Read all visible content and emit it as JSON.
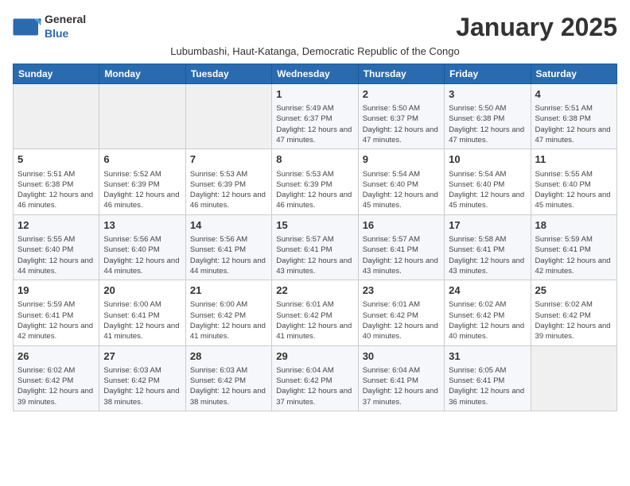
{
  "logo": {
    "general": "General",
    "blue": "Blue"
  },
  "title": "January 2025",
  "subtitle": "Lubumbashi, Haut-Katanga, Democratic Republic of the Congo",
  "days_of_week": [
    "Sunday",
    "Monday",
    "Tuesday",
    "Wednesday",
    "Thursday",
    "Friday",
    "Saturday"
  ],
  "weeks": [
    [
      {
        "day": "",
        "info": ""
      },
      {
        "day": "",
        "info": ""
      },
      {
        "day": "",
        "info": ""
      },
      {
        "day": "1",
        "info": "Sunrise: 5:49 AM\nSunset: 6:37 PM\nDaylight: 12 hours and 47 minutes."
      },
      {
        "day": "2",
        "info": "Sunrise: 5:50 AM\nSunset: 6:37 PM\nDaylight: 12 hours and 47 minutes."
      },
      {
        "day": "3",
        "info": "Sunrise: 5:50 AM\nSunset: 6:38 PM\nDaylight: 12 hours and 47 minutes."
      },
      {
        "day": "4",
        "info": "Sunrise: 5:51 AM\nSunset: 6:38 PM\nDaylight: 12 hours and 47 minutes."
      }
    ],
    [
      {
        "day": "5",
        "info": "Sunrise: 5:51 AM\nSunset: 6:38 PM\nDaylight: 12 hours and 46 minutes."
      },
      {
        "day": "6",
        "info": "Sunrise: 5:52 AM\nSunset: 6:39 PM\nDaylight: 12 hours and 46 minutes."
      },
      {
        "day": "7",
        "info": "Sunrise: 5:53 AM\nSunset: 6:39 PM\nDaylight: 12 hours and 46 minutes."
      },
      {
        "day": "8",
        "info": "Sunrise: 5:53 AM\nSunset: 6:39 PM\nDaylight: 12 hours and 46 minutes."
      },
      {
        "day": "9",
        "info": "Sunrise: 5:54 AM\nSunset: 6:40 PM\nDaylight: 12 hours and 45 minutes."
      },
      {
        "day": "10",
        "info": "Sunrise: 5:54 AM\nSunset: 6:40 PM\nDaylight: 12 hours and 45 minutes."
      },
      {
        "day": "11",
        "info": "Sunrise: 5:55 AM\nSunset: 6:40 PM\nDaylight: 12 hours and 45 minutes."
      }
    ],
    [
      {
        "day": "12",
        "info": "Sunrise: 5:55 AM\nSunset: 6:40 PM\nDaylight: 12 hours and 44 minutes."
      },
      {
        "day": "13",
        "info": "Sunrise: 5:56 AM\nSunset: 6:40 PM\nDaylight: 12 hours and 44 minutes."
      },
      {
        "day": "14",
        "info": "Sunrise: 5:56 AM\nSunset: 6:41 PM\nDaylight: 12 hours and 44 minutes."
      },
      {
        "day": "15",
        "info": "Sunrise: 5:57 AM\nSunset: 6:41 PM\nDaylight: 12 hours and 43 minutes."
      },
      {
        "day": "16",
        "info": "Sunrise: 5:57 AM\nSunset: 6:41 PM\nDaylight: 12 hours and 43 minutes."
      },
      {
        "day": "17",
        "info": "Sunrise: 5:58 AM\nSunset: 6:41 PM\nDaylight: 12 hours and 43 minutes."
      },
      {
        "day": "18",
        "info": "Sunrise: 5:59 AM\nSunset: 6:41 PM\nDaylight: 12 hours and 42 minutes."
      }
    ],
    [
      {
        "day": "19",
        "info": "Sunrise: 5:59 AM\nSunset: 6:41 PM\nDaylight: 12 hours and 42 minutes."
      },
      {
        "day": "20",
        "info": "Sunrise: 6:00 AM\nSunset: 6:41 PM\nDaylight: 12 hours and 41 minutes."
      },
      {
        "day": "21",
        "info": "Sunrise: 6:00 AM\nSunset: 6:42 PM\nDaylight: 12 hours and 41 minutes."
      },
      {
        "day": "22",
        "info": "Sunrise: 6:01 AM\nSunset: 6:42 PM\nDaylight: 12 hours and 41 minutes."
      },
      {
        "day": "23",
        "info": "Sunrise: 6:01 AM\nSunset: 6:42 PM\nDaylight: 12 hours and 40 minutes."
      },
      {
        "day": "24",
        "info": "Sunrise: 6:02 AM\nSunset: 6:42 PM\nDaylight: 12 hours and 40 minutes."
      },
      {
        "day": "25",
        "info": "Sunrise: 6:02 AM\nSunset: 6:42 PM\nDaylight: 12 hours and 39 minutes."
      }
    ],
    [
      {
        "day": "26",
        "info": "Sunrise: 6:02 AM\nSunset: 6:42 PM\nDaylight: 12 hours and 39 minutes."
      },
      {
        "day": "27",
        "info": "Sunrise: 6:03 AM\nSunset: 6:42 PM\nDaylight: 12 hours and 38 minutes."
      },
      {
        "day": "28",
        "info": "Sunrise: 6:03 AM\nSunset: 6:42 PM\nDaylight: 12 hours and 38 minutes."
      },
      {
        "day": "29",
        "info": "Sunrise: 6:04 AM\nSunset: 6:42 PM\nDaylight: 12 hours and 37 minutes."
      },
      {
        "day": "30",
        "info": "Sunrise: 6:04 AM\nSunset: 6:41 PM\nDaylight: 12 hours and 37 minutes."
      },
      {
        "day": "31",
        "info": "Sunrise: 6:05 AM\nSunset: 6:41 PM\nDaylight: 12 hours and 36 minutes."
      },
      {
        "day": "",
        "info": ""
      }
    ]
  ]
}
